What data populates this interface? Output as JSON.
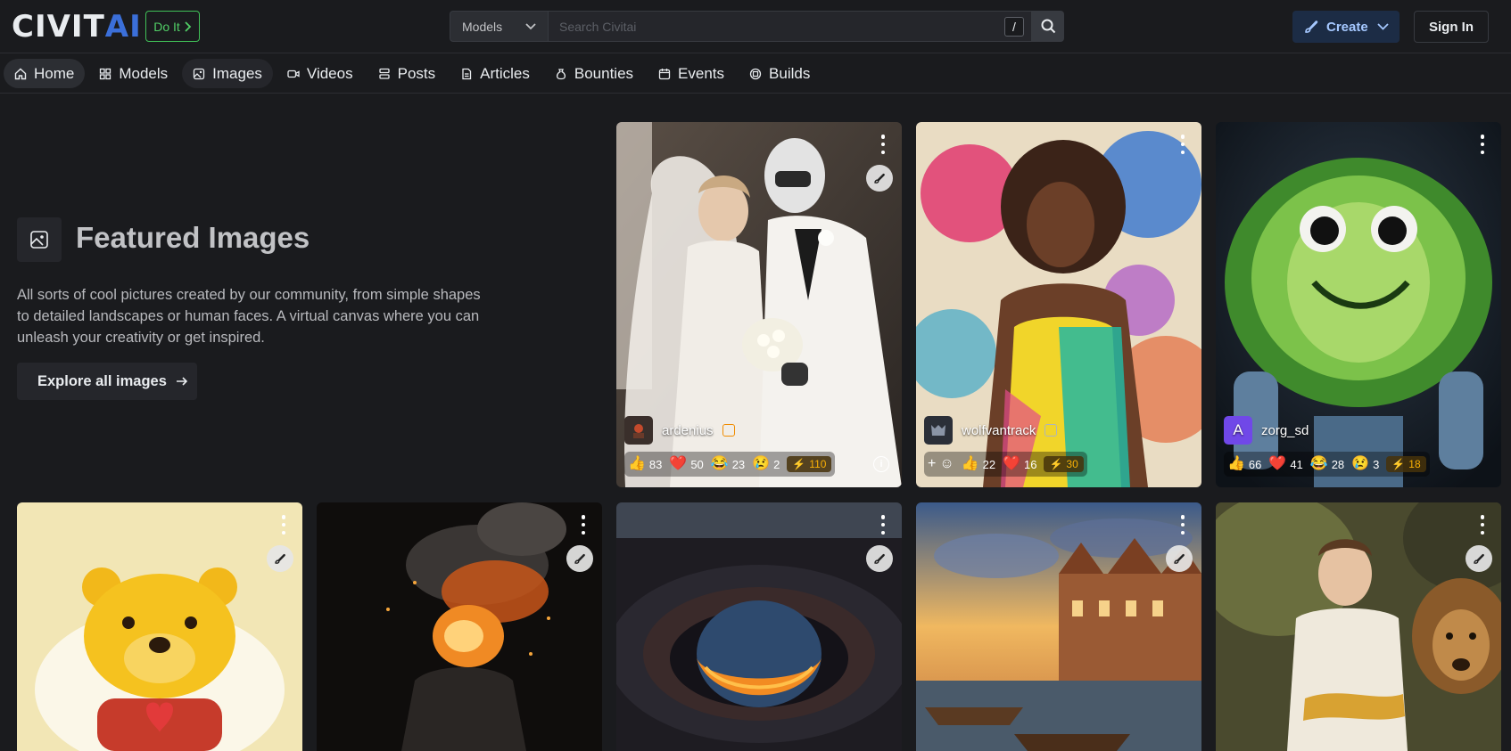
{
  "header": {
    "logo_main": "CIVIT",
    "logo_accent": "AI",
    "doit_label": "Do It",
    "search_category": "Models",
    "search_placeholder": "Search Civitai",
    "search_shortcut": "/",
    "create_label": "Create",
    "signin_label": "Sign In"
  },
  "nav": {
    "items": [
      {
        "label": "Home",
        "icon": "home-icon"
      },
      {
        "label": "Models",
        "icon": "models-icon"
      },
      {
        "label": "Images",
        "icon": "images-icon"
      },
      {
        "label": "Videos",
        "icon": "videos-icon"
      },
      {
        "label": "Posts",
        "icon": "posts-icon"
      },
      {
        "label": "Articles",
        "icon": "articles-icon"
      },
      {
        "label": "Bounties",
        "icon": "bounties-icon"
      },
      {
        "label": "Events",
        "icon": "events-icon"
      },
      {
        "label": "Builds",
        "icon": "builds-icon"
      }
    ],
    "active": "Home"
  },
  "featured": {
    "title": "Featured Images",
    "description": "All sorts of cool pictures created by our community, from simple shapes to detailed landscapes or human faces. A virtual canvas where you can unleash your creativity or get inspired.",
    "explore_label": "Explore all images"
  },
  "cards": [
    {
      "subject": "wedding-robot",
      "username": "ardenius",
      "likes": "83",
      "hearts": "50",
      "laughs": "23",
      "cries": "2",
      "buzz": "110"
    },
    {
      "subject": "paint-splash-woman",
      "username": "wolfvantrack",
      "likes": "22",
      "hearts": "16",
      "buzz": "30"
    },
    {
      "subject": "cabbage-robot",
      "username": "zorg_sd",
      "avatar_letter": "A",
      "likes": "66",
      "hearts": "41",
      "laughs": "28",
      "cries": "3",
      "buzz": "18"
    },
    {
      "subject": "cartoon-bear"
    },
    {
      "subject": "exploding-head"
    },
    {
      "subject": "lava-planet"
    },
    {
      "subject": "canal-town"
    },
    {
      "subject": "woman-with-lion"
    }
  ]
}
